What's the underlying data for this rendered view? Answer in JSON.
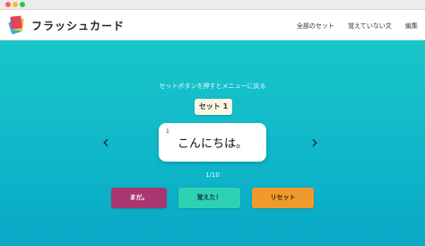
{
  "window": {
    "controls": [
      "close",
      "minimize",
      "maximize"
    ]
  },
  "header": {
    "app_title": "フラッシュカード",
    "logo_icon": "flashcards-logo-icon",
    "nav": {
      "all_sets": "全部のセット",
      "not_learned": "覚えていない文",
      "edit": "編集"
    }
  },
  "main": {
    "hint": "セットボタンを押すとメニューに戻る",
    "set_button": "セット 1",
    "prev_arrow": "‹",
    "next_arrow": "›",
    "card": {
      "number": "1",
      "text": "こんにちは。"
    },
    "counter": "1/10",
    "buttons": {
      "not_yet": "まだ。",
      "learned": "覚えた！",
      "reset": "リセット"
    }
  },
  "colors": {
    "background_top": "#19c6c9",
    "background_bottom": "#0aa7c6",
    "not_yet": "#a8366f",
    "learned": "#2fd1b3",
    "reset": "#ef9a2c"
  }
}
